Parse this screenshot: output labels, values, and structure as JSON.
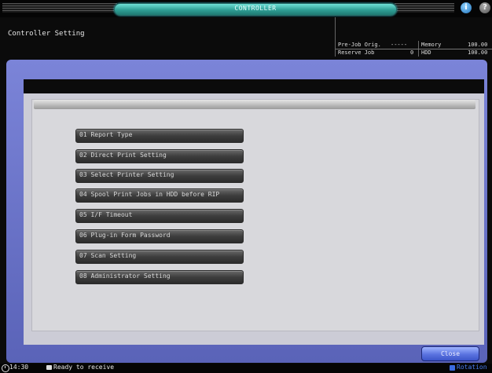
{
  "header": {
    "tab_label": "CONTROLLER",
    "screen_title": "Controller Setting",
    "help_icons": [
      "info-icon",
      "help-icon"
    ]
  },
  "status_panel": {
    "pre_job_label": "Pre-Job Orig.",
    "pre_job_value": "-----",
    "reserve_job_label": "Reserve Job",
    "reserve_job_value": "0",
    "memory_label": "Memory",
    "memory_value": "100.00",
    "hdd_label": "HDD",
    "hdd_value": "100.00"
  },
  "menu": {
    "items": [
      {
        "label": "01 Report Type"
      },
      {
        "label": "02 Direct Print Setting"
      },
      {
        "label": "03 Select Printer Setting"
      },
      {
        "label": "04 Spool Print Jobs in HDD before RIP"
      },
      {
        "label": "05 I/F Timeout"
      },
      {
        "label": "06 Plug-in Form Password"
      },
      {
        "label": "07 Scan Setting"
      },
      {
        "label": "08 Administrator Setting"
      }
    ]
  },
  "footer": {
    "close_label": "Close",
    "time": "14:30",
    "status_text": "Ready to receive",
    "rotation_label": "Rotation"
  },
  "colors": {
    "frame": "#6a74c8",
    "panel": "#ccccd6",
    "tab_accent": "#2f9e95",
    "close_button": "#5a73e0"
  }
}
